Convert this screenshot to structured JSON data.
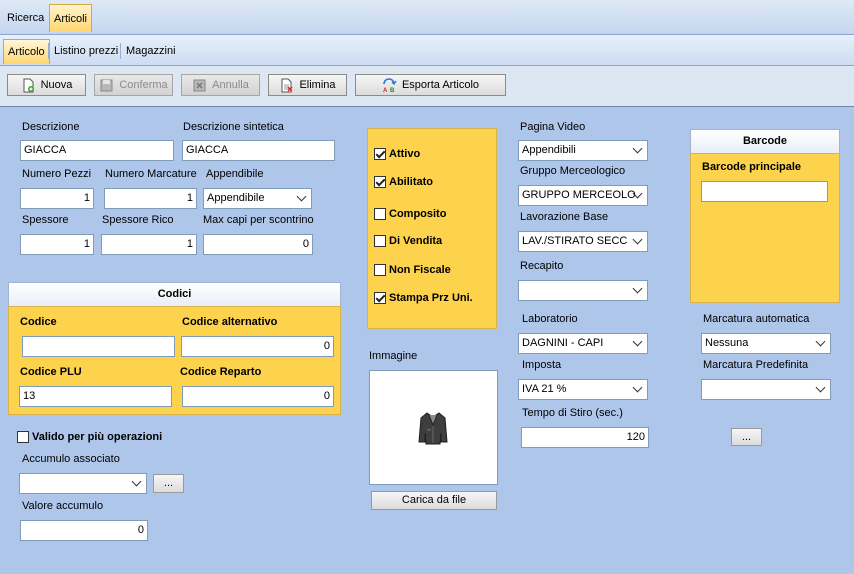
{
  "top_tabs": [
    {
      "label": "Ricerca"
    },
    {
      "label": "Articoli"
    }
  ],
  "sub_tabs": [
    {
      "label": "Articolo"
    },
    {
      "label": "Listino prezzi"
    },
    {
      "label": "Magazzini"
    }
  ],
  "toolbar": {
    "nuova": "Nuova",
    "conferma": "Conferma",
    "annulla": "Annulla",
    "elimina": "Elimina",
    "esporta": "Esporta Articolo"
  },
  "form": {
    "descrizione_label": "Descrizione",
    "descrizione_value": "GIACCA",
    "desc_sintetica_label": "Descrizione sintetica",
    "desc_sintetica_value": "GIACCA",
    "numero_pezzi_label": "Numero Pezzi",
    "numero_pezzi_value": "1",
    "numero_marcature_label": "Numero Marcature",
    "numero_marcature_value": "1",
    "appendibile_label": "Appendibile",
    "appendibile_value": "Appendibile",
    "spessore_label": "Spessore",
    "spessore_value": "1",
    "spessore_rico_label": "Spessore Rico",
    "spessore_rico_value": "1",
    "max_capi_label": "Max capi per scontrino",
    "max_capi_value": "0"
  },
  "codici": {
    "title": "Codici",
    "codice_label": "Codice",
    "codice_value": "",
    "codice_alt_label": "Codice alternativo",
    "codice_alt_value": "0",
    "codice_plu_label": "Codice PLU",
    "codice_plu_value": "13",
    "codice_reparto_label": "Codice Reparto",
    "codice_reparto_value": "0"
  },
  "valido": {
    "label": "Valido per più operazioni",
    "checked": false
  },
  "accumulo": {
    "label": "Accumulo associato",
    "value": "",
    "ellipsis": "...",
    "valore_label": "Valore accumulo",
    "valore_value": "0"
  },
  "flags": [
    {
      "label": "Attivo",
      "checked": true
    },
    {
      "label": "Abilitato",
      "checked": true
    },
    {
      "label": "Composito",
      "checked": false
    },
    {
      "label": "Di Vendita",
      "checked": false
    },
    {
      "label": "Non Fiscale",
      "checked": false
    },
    {
      "label": "Stampa Prz Uni.",
      "checked": true
    }
  ],
  "immagine": {
    "label": "Immagine",
    "button": "Carica da file",
    "icon": "jacket-icon"
  },
  "right": {
    "pagina_video_label": "Pagina Video",
    "pagina_video_value": "Appendibili",
    "gruppo_label": "Gruppo Merceologico",
    "gruppo_value": "GRUPPO MERCEOLO",
    "lavorazione_label": "Lavorazione Base",
    "lavorazione_value": "LAV./STIRATO SECC",
    "recapito_label": "Recapito",
    "recapito_value": "",
    "laboratorio_label": "Laboratorio",
    "laboratorio_value": "DAGNINI - CAPI",
    "imposta_label": "Imposta",
    "imposta_value": "IVA 21 %",
    "tempo_label": "Tempo di Stiro (sec.)",
    "tempo_value": "120"
  },
  "barcode": {
    "title": "Barcode",
    "principale_label": "Barcode principale",
    "principale_value": ""
  },
  "marcatura": {
    "auto_label": "Marcatura automatica",
    "auto_value": "Nessuna",
    "predef_label": "Marcatura Predefinita",
    "predef_value": "",
    "ellipsis": "..."
  },
  "colors": {
    "background": "#aec6ea",
    "yellow_panel": "#fdd24d",
    "active_tab": "#ffd66e"
  }
}
